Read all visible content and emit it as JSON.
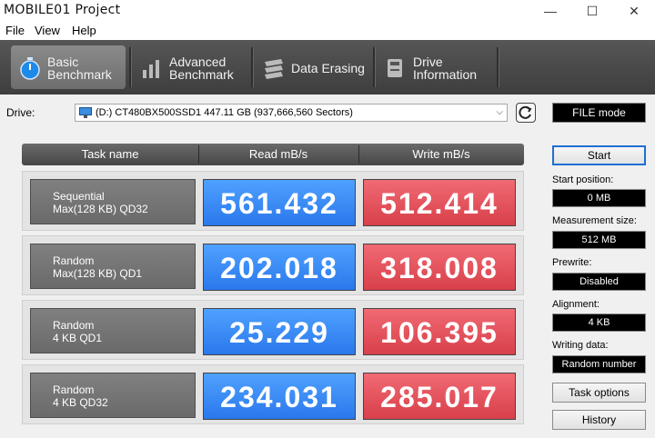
{
  "window": {
    "title": "MOBILE01 Project",
    "minimize_label": "—",
    "maximize_label": "☐",
    "close_label": "✕"
  },
  "menu": [
    "File",
    "View",
    "Help"
  ],
  "tabs": [
    {
      "label": "Basic\nBenchmark",
      "icon": "stopwatch-icon",
      "active": true
    },
    {
      "label": "Advanced\nBenchmark",
      "icon": "bar-chart-icon",
      "active": false
    },
    {
      "label": "Data Erasing",
      "icon": "erase-icon",
      "active": false
    },
    {
      "label": "Drive\nInformation",
      "icon": "drive-info-icon",
      "active": false
    }
  ],
  "drive": {
    "label": "Drive:",
    "selected": "(D:) CT480BX500SSD1  447.11 GB (937,666,560 Sectors)",
    "file_mode_label": "FILE mode"
  },
  "table": {
    "headers": [
      "Task name",
      "Read mB/s",
      "Write mB/s"
    ],
    "rows": [
      {
        "line1": "Sequential",
        "line2": "Max(128 KB) QD32",
        "read": "561.432",
        "write": "512.414"
      },
      {
        "line1": "Random",
        "line2": "Max(128 KB) QD1",
        "read": "202.018",
        "write": "318.008"
      },
      {
        "line1": "Random",
        "line2": "4 KB QD1",
        "read": "25.229",
        "write": "106.395"
      },
      {
        "line1": "Random",
        "line2": "4 KB QD32",
        "read": "234.031",
        "write": "285.017"
      }
    ]
  },
  "side": {
    "start_label": "Start",
    "start_position_label": "Start position:",
    "start_position_value": "0 MB",
    "measurement_size_label": "Measurement size:",
    "measurement_size_value": "512 MB",
    "prewrite_label": "Prewrite:",
    "prewrite_value": "Disabled",
    "alignment_label": "Alignment:",
    "alignment_value": "4 KB",
    "writing_data_label": "Writing data:",
    "writing_data_value": "Random number",
    "task_options_label": "Task options",
    "history_label": "History"
  },
  "colors": {
    "read": "#2a78ec",
    "write": "#d8404a",
    "accent": "#1f6fd2"
  }
}
